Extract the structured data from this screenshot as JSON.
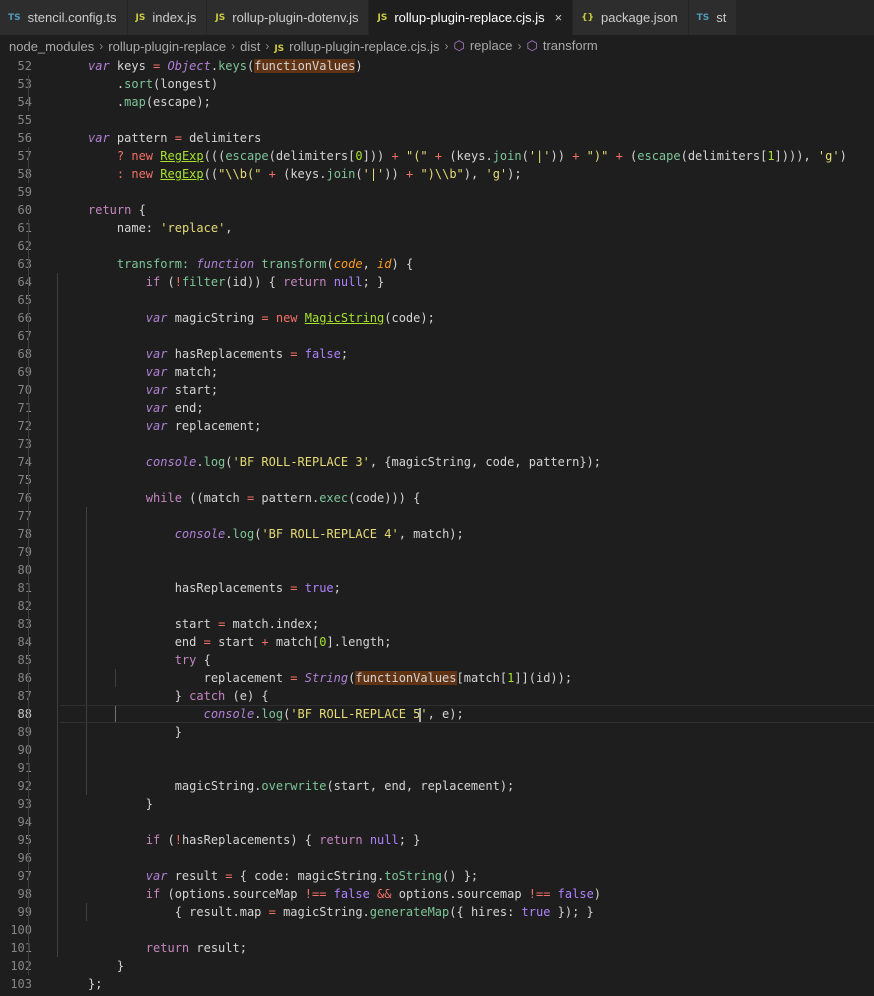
{
  "colors": {
    "keyword": "#c586c0",
    "storage": "#b180d7",
    "operator": "#f47067",
    "func": "#7ec699",
    "string": "#e6db74",
    "number": "#a6e22e",
    "constant": "#ae81ff",
    "variable": "#d4d4d4",
    "class": "#a6e22e"
  },
  "tabs": [
    {
      "icon": "TS",
      "icon_color": "#519aba",
      "label": "stencil.config.ts",
      "active": false
    },
    {
      "icon": "JS",
      "icon_color": "#cbcb41",
      "label": "index.js",
      "active": false
    },
    {
      "icon": "JS",
      "icon_color": "#cbcb41",
      "label": "rollup-plugin-dotenv.js",
      "active": false
    },
    {
      "icon": "JS",
      "icon_color": "#cbcb41",
      "label": "rollup-plugin-replace.cjs.js",
      "active": true,
      "close": "×"
    },
    {
      "icon": "{}",
      "icon_color": "#cbcb41",
      "label": "package.json",
      "active": false
    },
    {
      "icon": "TS",
      "icon_color": "#519aba",
      "label": "st",
      "active": false
    }
  ],
  "breadcrumbs": [
    {
      "label": "node_modules"
    },
    {
      "label": "rollup-plugin-replace"
    },
    {
      "label": "dist"
    },
    {
      "icon": "JS",
      "label": "rollup-plugin-replace.cjs.js"
    },
    {
      "sym": "⬡",
      "label": "replace"
    },
    {
      "sym": "⬡",
      "label": "transform"
    }
  ],
  "code": [
    {
      "n": "52",
      "indent": 1,
      "t": [
        [
          "var ",
          "storage"
        ],
        [
          "keys ",
          "variable"
        ],
        [
          "= ",
          "operator"
        ],
        [
          "Object",
          "storage"
        ],
        [
          ".",
          "variable"
        ],
        [
          "keys",
          "func"
        ],
        [
          "(",
          "variable"
        ],
        [
          "functionValues",
          "hl"
        ],
        [
          ")",
          "variable"
        ]
      ]
    },
    {
      "n": "53",
      "indent": 2,
      "t": [
        [
          ".",
          "variable"
        ],
        [
          "sort",
          "func"
        ],
        [
          "(longest)",
          "variable"
        ]
      ]
    },
    {
      "n": "54",
      "indent": 2,
      "t": [
        [
          ".",
          "variable"
        ],
        [
          "map",
          "func"
        ],
        [
          "(escape);",
          "variable"
        ]
      ]
    },
    {
      "n": "55",
      "indent": 1,
      "t": []
    },
    {
      "n": "56",
      "indent": 1,
      "t": [
        [
          "var ",
          "storage"
        ],
        [
          "pattern ",
          "variable"
        ],
        [
          "= ",
          "operator"
        ],
        [
          "delimiters",
          "variable"
        ]
      ]
    },
    {
      "n": "57",
      "indent": 2,
      "t": [
        [
          "? ",
          "operator"
        ],
        [
          "new ",
          "operator"
        ],
        [
          "RegExp",
          "classu"
        ],
        [
          "(((",
          "variable"
        ],
        [
          "escape",
          "func"
        ],
        [
          "(delimiters[",
          "variable"
        ],
        [
          "0",
          "number"
        ],
        [
          "])) ",
          "variable"
        ],
        [
          "+ ",
          "operator"
        ],
        [
          "\"(\" ",
          "string"
        ],
        [
          "+ ",
          "operator"
        ],
        [
          "(keys.",
          "variable"
        ],
        [
          "join",
          "func"
        ],
        [
          "(",
          "variable"
        ],
        [
          "'|'",
          "string"
        ],
        [
          ")) ",
          "variable"
        ],
        [
          "+ ",
          "operator"
        ],
        [
          "\")\" ",
          "string"
        ],
        [
          "+ ",
          "operator"
        ],
        [
          "(",
          "variable"
        ],
        [
          "escape",
          "func"
        ],
        [
          "(delimiters[",
          "variable"
        ],
        [
          "1",
          "number"
        ],
        [
          "]))), ",
          "variable"
        ],
        [
          "'g'",
          "string"
        ],
        [
          ")",
          "variable"
        ]
      ]
    },
    {
      "n": "58",
      "indent": 2,
      "t": [
        [
          ": ",
          "operator"
        ],
        [
          "new ",
          "operator"
        ],
        [
          "RegExp",
          "classu"
        ],
        [
          "((",
          "variable"
        ],
        [
          "\"\\\\b(\" ",
          "string"
        ],
        [
          "+ ",
          "operator"
        ],
        [
          "(keys.",
          "variable"
        ],
        [
          "join",
          "func"
        ],
        [
          "(",
          "variable"
        ],
        [
          "'|'",
          "string"
        ],
        [
          ")) ",
          "variable"
        ],
        [
          "+ ",
          "operator"
        ],
        [
          "\")\\\\b\"",
          "string"
        ],
        [
          "), ",
          "variable"
        ],
        [
          "'g'",
          "string"
        ],
        [
          ");",
          "variable"
        ]
      ]
    },
    {
      "n": "59",
      "indent": 1,
      "t": []
    },
    {
      "n": "60",
      "indent": 1,
      "t": [
        [
          "return ",
          "keyword"
        ],
        [
          "{",
          "variable"
        ]
      ]
    },
    {
      "n": "61",
      "indent": 2,
      "t": [
        [
          "name: ",
          "variable"
        ],
        [
          "'replace'",
          "string"
        ],
        [
          ",",
          "variable"
        ]
      ]
    },
    {
      "n": "62",
      "indent": 2,
      "t": []
    },
    {
      "n": "63",
      "indent": 2,
      "t": [
        [
          "transform: ",
          "func"
        ],
        [
          "function ",
          "storage"
        ],
        [
          "transform",
          "func"
        ],
        [
          "(",
          "variable"
        ],
        [
          "code",
          "param"
        ],
        [
          ", ",
          "variable"
        ],
        [
          "id",
          "param"
        ],
        [
          ") {",
          "variable"
        ]
      ]
    },
    {
      "n": "64",
      "indent": 3,
      "t": [
        [
          "if ",
          "keyword"
        ],
        [
          "(",
          "variable"
        ],
        [
          "!",
          "operator"
        ],
        [
          "filter",
          "func"
        ],
        [
          "(id)) { ",
          "variable"
        ],
        [
          "return ",
          "keyword"
        ],
        [
          "null",
          "constant"
        ],
        [
          "; }",
          "variable"
        ]
      ]
    },
    {
      "n": "65",
      "indent": 3,
      "t": []
    },
    {
      "n": "66",
      "indent": 3,
      "t": [
        [
          "var ",
          "storage"
        ],
        [
          "magicString ",
          "variable"
        ],
        [
          "= ",
          "operator"
        ],
        [
          "new ",
          "operator"
        ],
        [
          "MagicString",
          "classu"
        ],
        [
          "(code);",
          "variable"
        ]
      ]
    },
    {
      "n": "67",
      "indent": 3,
      "t": []
    },
    {
      "n": "68",
      "indent": 3,
      "t": [
        [
          "var ",
          "storage"
        ],
        [
          "hasReplacements ",
          "variable"
        ],
        [
          "= ",
          "operator"
        ],
        [
          "false",
          "constant"
        ],
        [
          ";",
          "variable"
        ]
      ]
    },
    {
      "n": "69",
      "indent": 3,
      "t": [
        [
          "var ",
          "storage"
        ],
        [
          "match;",
          "variable"
        ]
      ]
    },
    {
      "n": "70",
      "indent": 3,
      "t": [
        [
          "var ",
          "storage"
        ],
        [
          "start;",
          "variable"
        ]
      ]
    },
    {
      "n": "71",
      "indent": 3,
      "t": [
        [
          "var ",
          "storage"
        ],
        [
          "end;",
          "variable"
        ]
      ]
    },
    {
      "n": "72",
      "indent": 3,
      "t": [
        [
          "var ",
          "storage"
        ],
        [
          "replacement;",
          "variable"
        ]
      ]
    },
    {
      "n": "73",
      "indent": 3,
      "t": []
    },
    {
      "n": "74",
      "indent": 3,
      "t": [
        [
          "console",
          "storage"
        ],
        [
          ".",
          "variable"
        ],
        [
          "log",
          "func"
        ],
        [
          "(",
          "variable"
        ],
        [
          "'BF ROLL-REPLACE 3'",
          "string"
        ],
        [
          ", {magicString, code, pattern});",
          "variable"
        ]
      ]
    },
    {
      "n": "75",
      "indent": 3,
      "t": []
    },
    {
      "n": "76",
      "indent": 3,
      "t": [
        [
          "while ",
          "keyword"
        ],
        [
          "((match ",
          "variable"
        ],
        [
          "= ",
          "operator"
        ],
        [
          "pattern.",
          "variable"
        ],
        [
          "exec",
          "func"
        ],
        [
          "(code))) {",
          "variable"
        ]
      ]
    },
    {
      "n": "77",
      "indent": 4,
      "t": []
    },
    {
      "n": "78",
      "indent": 4,
      "t": [
        [
          "console",
          "storage"
        ],
        [
          ".",
          "variable"
        ],
        [
          "log",
          "func"
        ],
        [
          "(",
          "variable"
        ],
        [
          "'BF ROLL-REPLACE 4'",
          "string"
        ],
        [
          ", match);",
          "variable"
        ]
      ]
    },
    {
      "n": "79",
      "indent": 4,
      "t": []
    },
    {
      "n": "80",
      "indent": 4,
      "t": []
    },
    {
      "n": "81",
      "indent": 4,
      "t": [
        [
          "hasReplacements ",
          "variable"
        ],
        [
          "= ",
          "operator"
        ],
        [
          "true",
          "constant"
        ],
        [
          ";",
          "variable"
        ]
      ]
    },
    {
      "n": "82",
      "indent": 4,
      "t": []
    },
    {
      "n": "83",
      "indent": 4,
      "t": [
        [
          "start ",
          "variable"
        ],
        [
          "= ",
          "operator"
        ],
        [
          "match.index;",
          "variable"
        ]
      ]
    },
    {
      "n": "84",
      "indent": 4,
      "t": [
        [
          "end ",
          "variable"
        ],
        [
          "= ",
          "operator"
        ],
        [
          "start ",
          "variable"
        ],
        [
          "+ ",
          "operator"
        ],
        [
          "match[",
          "variable"
        ],
        [
          "0",
          "number"
        ],
        [
          "].length;",
          "variable"
        ]
      ]
    },
    {
      "n": "85",
      "indent": 4,
      "t": [
        [
          "try ",
          "keyword"
        ],
        [
          "{",
          "variable"
        ]
      ]
    },
    {
      "n": "86",
      "indent": 5,
      "t": [
        [
          "replacement ",
          "variable"
        ],
        [
          "= ",
          "operator"
        ],
        [
          "String",
          "storage"
        ],
        [
          "(",
          "variable"
        ],
        [
          "functionValues",
          "hl"
        ],
        [
          "[match[",
          "variable"
        ],
        [
          "1",
          "number"
        ],
        [
          "]](id));",
          "variable"
        ]
      ]
    },
    {
      "n": "87",
      "indent": 4,
      "t": [
        [
          "} ",
          "variable"
        ],
        [
          "catch ",
          "keyword"
        ],
        [
          "(e) {",
          "variable"
        ]
      ]
    },
    {
      "n": "88",
      "indent": 5,
      "current": true,
      "t": [
        [
          "console",
          "storage"
        ],
        [
          ".",
          "variable"
        ],
        [
          "log",
          "func"
        ],
        [
          "(",
          "variable"
        ],
        [
          "'BF ROLL-REPLACE 5",
          "string"
        ],
        [
          "|cursor",
          "cursor"
        ],
        [
          "'",
          "string"
        ],
        [
          ", e);",
          "variable"
        ]
      ]
    },
    {
      "n": "89",
      "indent": 4,
      "t": [
        [
          "}",
          "variable"
        ]
      ]
    },
    {
      "n": "90",
      "indent": 4,
      "t": []
    },
    {
      "n": "91",
      "indent": 4,
      "t": []
    },
    {
      "n": "92",
      "indent": 4,
      "t": [
        [
          "magicString.",
          "variable"
        ],
        [
          "overwrite",
          "func"
        ],
        [
          "(start, end, replacement);",
          "variable"
        ]
      ]
    },
    {
      "n": "93",
      "indent": 3,
      "t": [
        [
          "}",
          "variable"
        ]
      ]
    },
    {
      "n": "94",
      "indent": 3,
      "t": []
    },
    {
      "n": "95",
      "indent": 3,
      "t": [
        [
          "if ",
          "keyword"
        ],
        [
          "(",
          "variable"
        ],
        [
          "!",
          "operator"
        ],
        [
          "hasReplacements) { ",
          "variable"
        ],
        [
          "return ",
          "keyword"
        ],
        [
          "null",
          "constant"
        ],
        [
          "; }",
          "variable"
        ]
      ]
    },
    {
      "n": "96",
      "indent": 3,
      "t": []
    },
    {
      "n": "97",
      "indent": 3,
      "t": [
        [
          "var ",
          "storage"
        ],
        [
          "result ",
          "variable"
        ],
        [
          "= ",
          "operator"
        ],
        [
          "{ code: magicString.",
          "variable"
        ],
        [
          "toString",
          "func"
        ],
        [
          "() };",
          "variable"
        ]
      ]
    },
    {
      "n": "98",
      "indent": 3,
      "t": [
        [
          "if ",
          "keyword"
        ],
        [
          "(options.sourceMap ",
          "variable"
        ],
        [
          "!== ",
          "operator"
        ],
        [
          "false ",
          "constant"
        ],
        [
          "&& ",
          "operator"
        ],
        [
          "options.sourcemap ",
          "variable"
        ],
        [
          "!== ",
          "operator"
        ],
        [
          "false",
          "constant"
        ],
        [
          ")",
          "variable"
        ]
      ]
    },
    {
      "n": "99",
      "indent": 4,
      "t": [
        [
          "{ result.map ",
          "variable"
        ],
        [
          "= ",
          "operator"
        ],
        [
          "magicString.",
          "variable"
        ],
        [
          "generateMap",
          "func"
        ],
        [
          "({ hires: ",
          "variable"
        ],
        [
          "true ",
          "constant"
        ],
        [
          "}); }",
          "variable"
        ]
      ]
    },
    {
      "n": "100",
      "indent": 3,
      "t": []
    },
    {
      "n": "101",
      "indent": 3,
      "t": [
        [
          "return ",
          "keyword"
        ],
        [
          "result;",
          "variable"
        ]
      ]
    },
    {
      "n": "102",
      "indent": 2,
      "t": [
        [
          "}",
          "variable"
        ]
      ]
    },
    {
      "n": "103",
      "indent": 1,
      "t": [
        [
          "};",
          "variable"
        ]
      ]
    }
  ]
}
